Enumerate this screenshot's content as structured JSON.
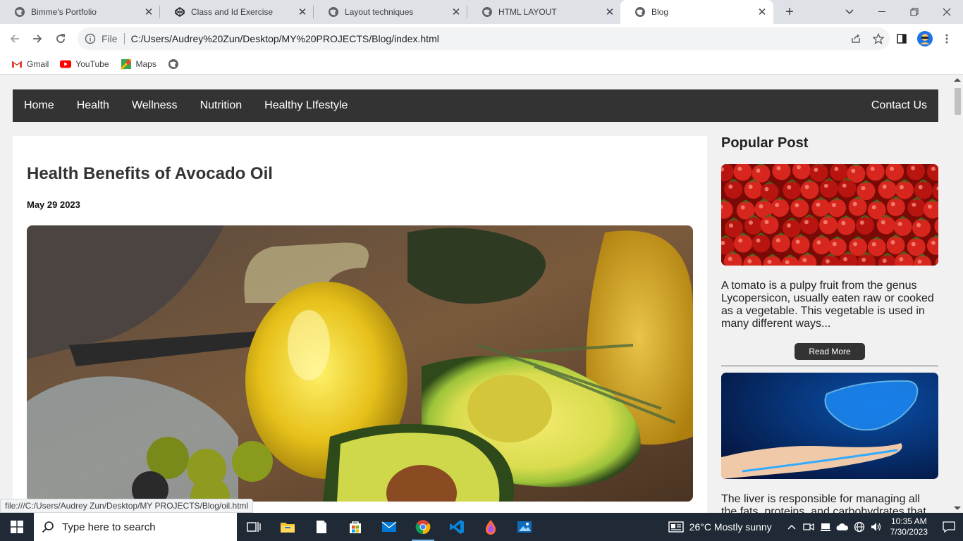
{
  "browser": {
    "tabs": [
      {
        "title": "Bimme's Portfolio",
        "favicon": "globe-icon"
      },
      {
        "title": "Class and Id Exercise",
        "favicon": "codepen-icon"
      },
      {
        "title": "Layout techniques",
        "favicon": "globe-icon"
      },
      {
        "title": "HTML LAYOUT",
        "favicon": "globe-icon"
      },
      {
        "title": "Blog",
        "favicon": "globe-icon",
        "active": true
      }
    ],
    "address": {
      "scheme_label": "File",
      "url": "C:/Users/Audrey%20Zun/Desktop/MY%20PROJECTS/Blog/index.html"
    },
    "bookmarks": [
      {
        "label": "Gmail",
        "icon": "gmail-icon"
      },
      {
        "label": "YouTube",
        "icon": "youtube-icon"
      },
      {
        "label": "Maps",
        "icon": "maps-icon"
      }
    ],
    "status_url": "file:///C:/Users/Audrey Zun/Desktop/MY PROJECTS/Blog/oil.html"
  },
  "site": {
    "nav": [
      "Home",
      "Health",
      "Wellness",
      "Nutrition",
      "Healthy LIfestyle"
    ],
    "contact": "Contact Us",
    "article": {
      "title": "Health Benefits of Avocado Oil",
      "date": "May 29 2023"
    },
    "sidebar": {
      "heading": "Popular Post",
      "posts": [
        {
          "text": "A tomato is a pulpy fruit from the genus Lycopersicon, usually eaten raw or cooked as a vegetable. This vegetable is used in many different ways...",
          "button": "Read More"
        },
        {
          "text": "The liver is responsible for managing all the fats, proteins, and carbohydrates that"
        }
      ]
    }
  },
  "taskbar": {
    "search_placeholder": "Type here to search",
    "weather": "26°C  Mostly sunny",
    "time": "10:35 AM",
    "date": "7/30/2023"
  },
  "colors": {
    "nav_bg": "#333333",
    "page_bg": "#f1f1f1",
    "taskbar_bg": "#1f2a36"
  }
}
